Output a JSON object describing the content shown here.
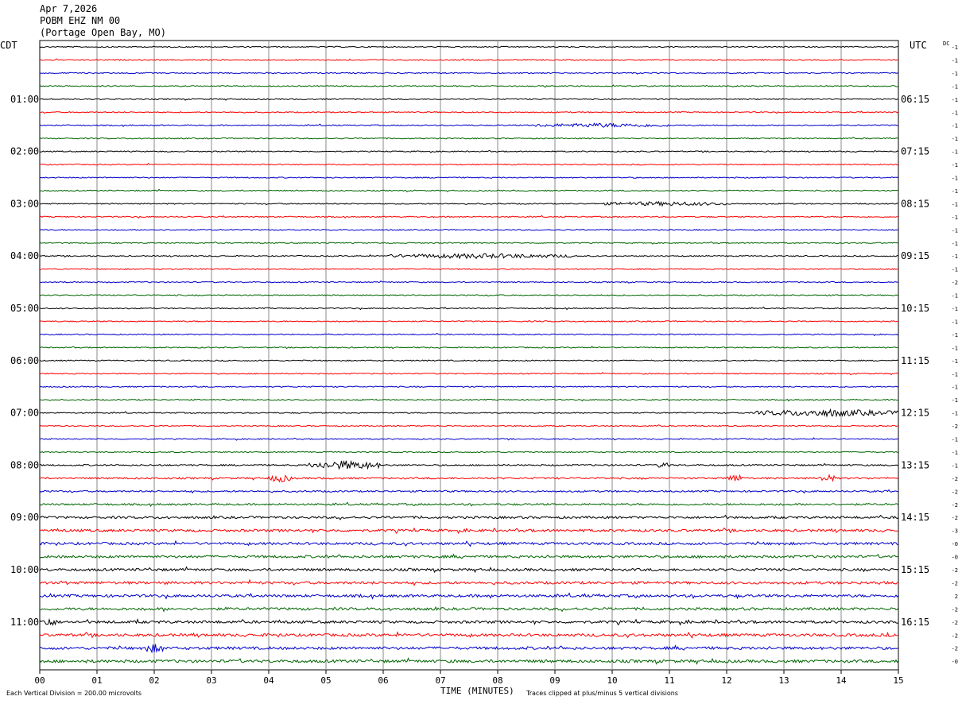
{
  "header": {
    "date": "Apr 7,2026",
    "station": "POBM EHZ NM 00",
    "location": "(Portage Open Bay, MO)"
  },
  "left_timezone": "CDT",
  "right_timezone": "UTC",
  "dc_label": "DC",
  "footer": {
    "scale_note": "Each Vertical Division =  200.00 microvolts",
    "xlabel": "TIME (MINUTES)",
    "clip_note": "Traces clipped at plus/minus 5 vertical divisions"
  },
  "colors": {
    "trace_cycle": [
      "#000000",
      "#ff0000",
      "#0000cc",
      "#006600"
    ],
    "grid": "#888888",
    "background": "#ffffff"
  },
  "chart_data": {
    "type": "line",
    "subtype": "helicorder",
    "title": "",
    "xlabel": "TIME (MINUTES)",
    "xlim": [
      0,
      15
    ],
    "x_ticks": [
      "00",
      "01",
      "02",
      "03",
      "04",
      "05",
      "06",
      "07",
      "08",
      "09",
      "10",
      "11",
      "12",
      "13",
      "14",
      "15"
    ],
    "left_hour_labels": [
      "01:00",
      "02:00",
      "03:00",
      "04:00",
      "05:00",
      "06:00",
      "07:00",
      "08:00",
      "09:00",
      "10:00",
      "11:00"
    ],
    "right_hour_labels": [
      "06:15",
      "07:15",
      "08:15",
      "09:15",
      "10:15",
      "11:15",
      "12:15",
      "13:15",
      "14:15",
      "15:15",
      "16:15"
    ],
    "trace_count": 48,
    "dc_offsets": [
      "-1",
      "-1",
      "-1",
      "-1",
      "-1",
      "-1",
      "-1",
      "-1",
      "-1",
      "-1",
      "-1",
      "-1",
      "-1",
      "-1",
      "-1",
      "-1",
      "-1",
      "-1",
      "-2",
      "-1",
      "-1",
      "-1",
      "-1",
      "-1",
      "-1",
      "-1",
      "-1",
      "-1",
      "-1",
      "-2",
      "-1",
      "-1",
      "-1",
      "-2",
      "-2",
      "-2",
      "-2",
      "-3",
      "-0",
      "-0",
      "-2",
      "-2",
      "2",
      "-2",
      "-2",
      "-2",
      "-2",
      "-0"
    ],
    "activity_level": [
      1,
      1,
      1,
      1,
      1,
      1,
      1,
      1,
      1,
      1,
      1,
      1,
      1,
      1,
      1,
      1,
      1,
      1,
      1,
      1,
      1,
      1,
      1,
      1,
      1,
      1,
      1,
      1,
      1,
      1,
      1,
      1,
      1.3,
      1.5,
      1.5,
      1.6,
      2,
      2.2,
      2.2,
      2.2,
      2.2,
      2.3,
      2.3,
      2.3,
      2.3,
      2.4,
      2.4,
      2.5
    ],
    "events": [
      {
        "trace": 6,
        "start_min": 8.6,
        "end_min": 11.0,
        "level": 2
      },
      {
        "trace": 12,
        "start_min": 9.8,
        "end_min": 12.0,
        "level": 2
      },
      {
        "trace": 16,
        "start_min": 6.0,
        "end_min": 9.3,
        "level": 2.5
      },
      {
        "trace": 28,
        "start_min": 12.5,
        "end_min": 15.0,
        "level": 4
      },
      {
        "trace": 32,
        "start_min": 4.7,
        "end_min": 6.0,
        "level": 5
      },
      {
        "trace": 32,
        "start_min": 10.8,
        "end_min": 11.0,
        "level": 4
      },
      {
        "trace": 33,
        "start_min": 4.0,
        "end_min": 4.4,
        "level": 4
      },
      {
        "trace": 33,
        "start_min": 12.0,
        "end_min": 12.3,
        "level": 4
      },
      {
        "trace": 33,
        "start_min": 13.6,
        "end_min": 13.9,
        "level": 4
      },
      {
        "trace": 44,
        "start_min": 0.0,
        "end_min": 0.3,
        "level": 4
      },
      {
        "trace": 46,
        "start_min": 1.8,
        "end_min": 2.2,
        "level": 4
      }
    ]
  }
}
